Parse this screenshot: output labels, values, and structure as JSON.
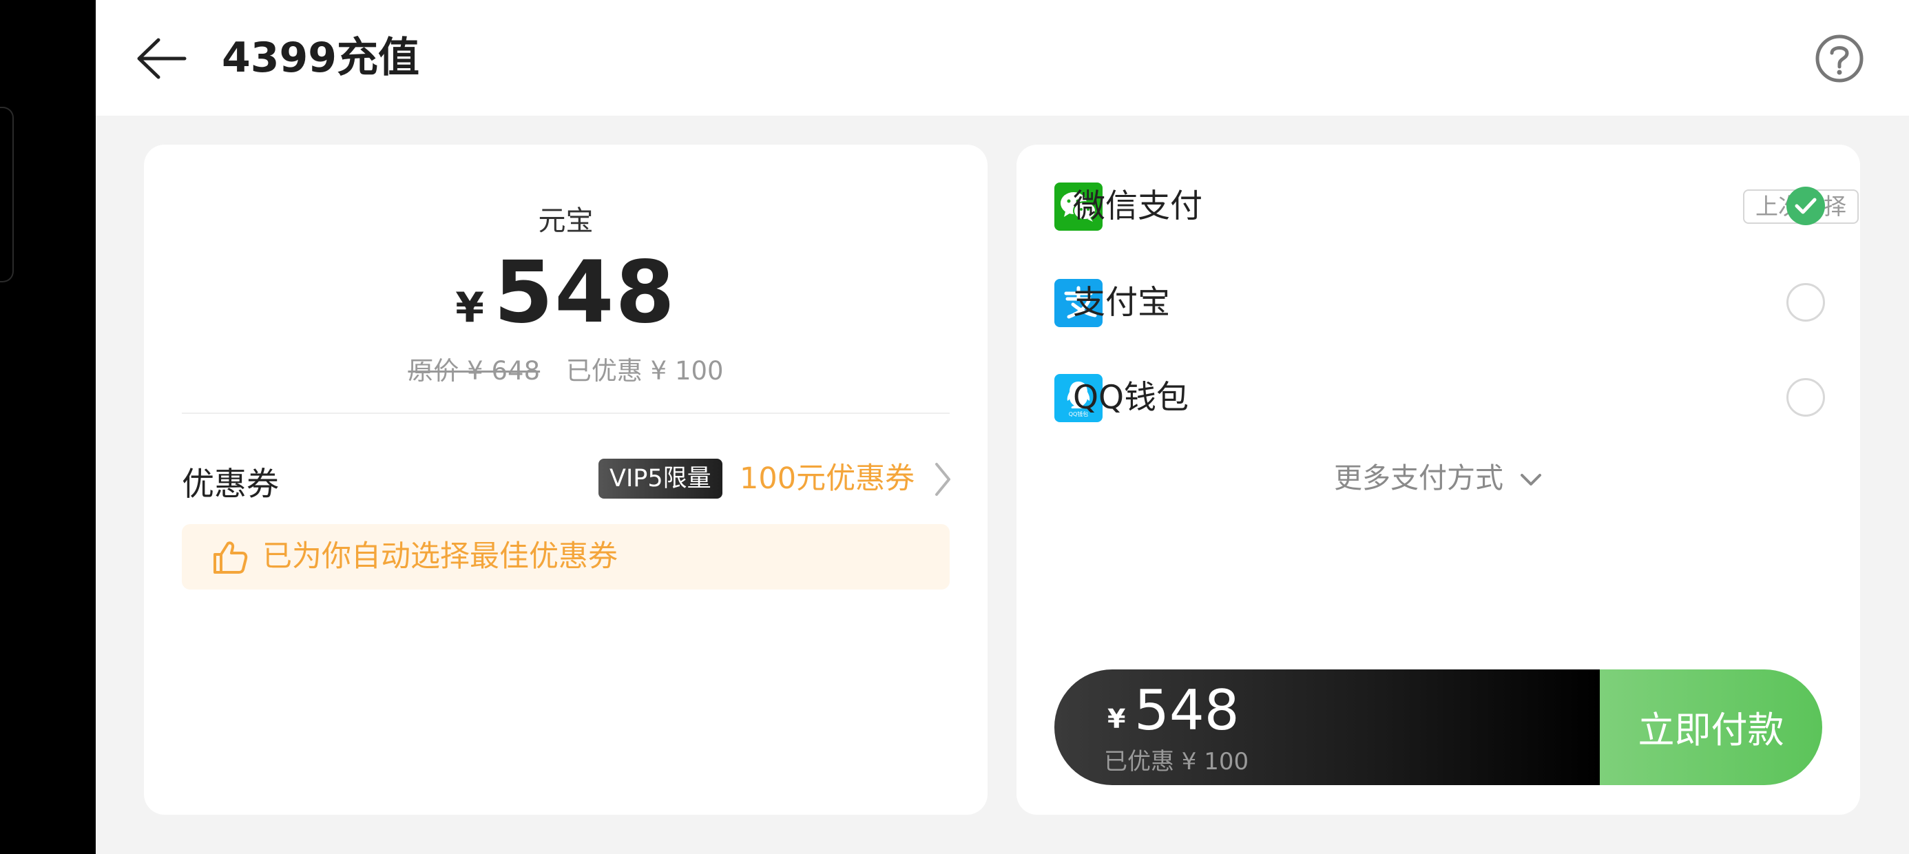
{
  "header": {
    "title": "4399充值"
  },
  "product": {
    "label": "元宝",
    "currency": "¥",
    "price": "548",
    "original_price": "原价 ¥ 648",
    "discount_text": "已优惠 ¥ 100"
  },
  "coupon": {
    "label": "优惠券",
    "vip_tag": "VIP5限量",
    "value": "100元优惠券",
    "tip": "已为你自动选择最佳优惠券"
  },
  "payment": {
    "methods": [
      {
        "name": "微信支付",
        "icon": "wechat-pay-icon",
        "selected": true,
        "tag": "上次选择"
      },
      {
        "name": "支付宝",
        "icon": "alipay-icon",
        "selected": false
      },
      {
        "name": "QQ钱包",
        "icon": "qq-wallet-icon",
        "selected": false
      }
    ],
    "more": "更多支付方式"
  },
  "paybar": {
    "currency": "¥",
    "amount": "548",
    "discount": "已优惠 ¥ 100",
    "button": "立即付款"
  },
  "colors": {
    "accent_orange": "#f4a53a",
    "green": "#41b86a",
    "pay_button": "#5cc45a",
    "wechat": "#1aad19",
    "alipay": "#1677ff",
    "qq": "#12b7f5"
  }
}
